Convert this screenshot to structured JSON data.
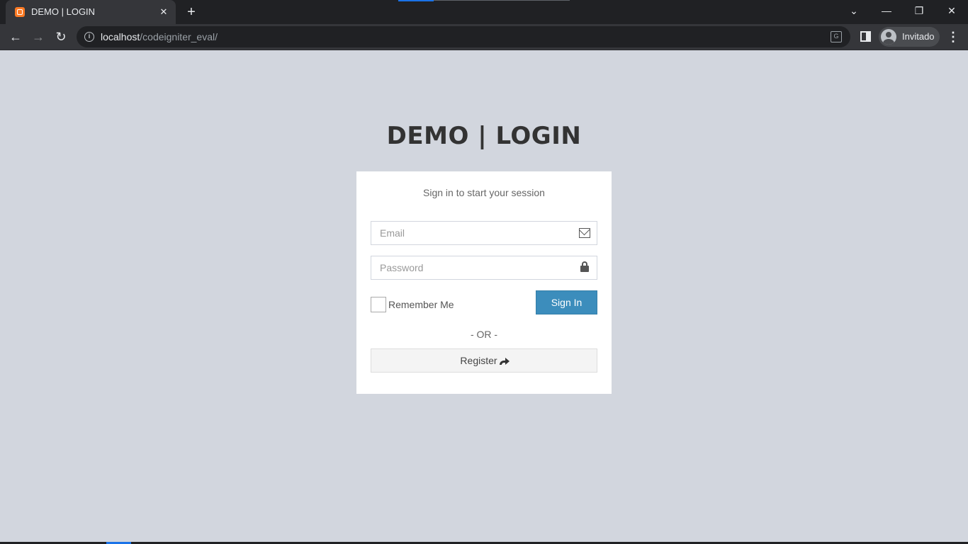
{
  "browser": {
    "tab_title": "DEMO | LOGIN",
    "tab_close": "✕",
    "new_tab": "+",
    "url_host": "localhost",
    "url_path": "/codeigniter_eval/",
    "profile_name": "Invitado",
    "minimize": "—",
    "restore": "❐",
    "close": "✕",
    "tab_search": "⌄"
  },
  "page": {
    "logo": "DEMO | LOGIN",
    "login_message": "Sign in to start your session",
    "email_placeholder": "Email",
    "password_placeholder": "Password",
    "remember_label": "Remember Me",
    "signin_label": "Sign In",
    "or_text": "- OR -",
    "register_label": "Register"
  },
  "colors": {
    "background": "#d2d6de",
    "primary_button": "#3c8dbc",
    "browser_dark": "#202124"
  }
}
